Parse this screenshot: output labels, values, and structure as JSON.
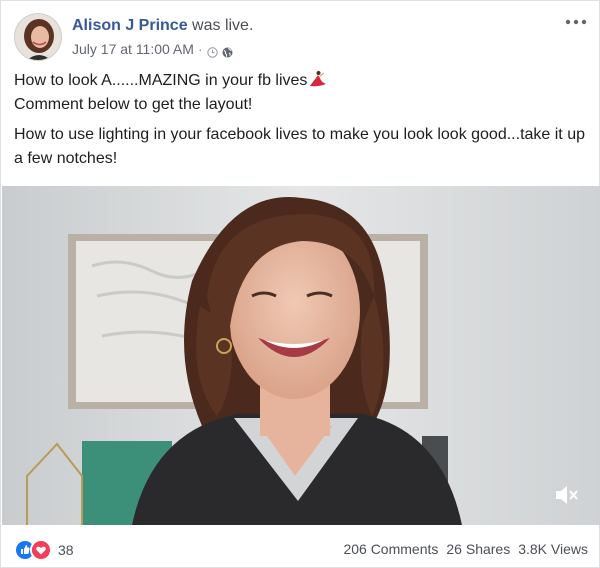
{
  "post": {
    "author": "Alison J Prince",
    "verb": "was live.",
    "timestamp": "July 17 at 11:00 AM",
    "separator": "·",
    "text_line1": "How to look A......MAZING in your fb lives",
    "text_line2": "Comment below to get the layout!",
    "text_line3": "How to use lighting in your facebook lives to make you look look good...take it up a few notches!",
    "reaction_count": "38",
    "comments": "206 Comments",
    "shares": "26 Shares",
    "views": "3.8K Views"
  },
  "icons": [
    "avatar",
    "clock-icon",
    "globe-icon",
    "more-options-icon",
    "dancer-emoji",
    "mute-icon",
    "like-icon",
    "love-icon"
  ],
  "colors": {
    "author_link": "#385898",
    "like_blue": "#1877f2",
    "love_red": "#f33e58",
    "border": "#dddfe2"
  }
}
